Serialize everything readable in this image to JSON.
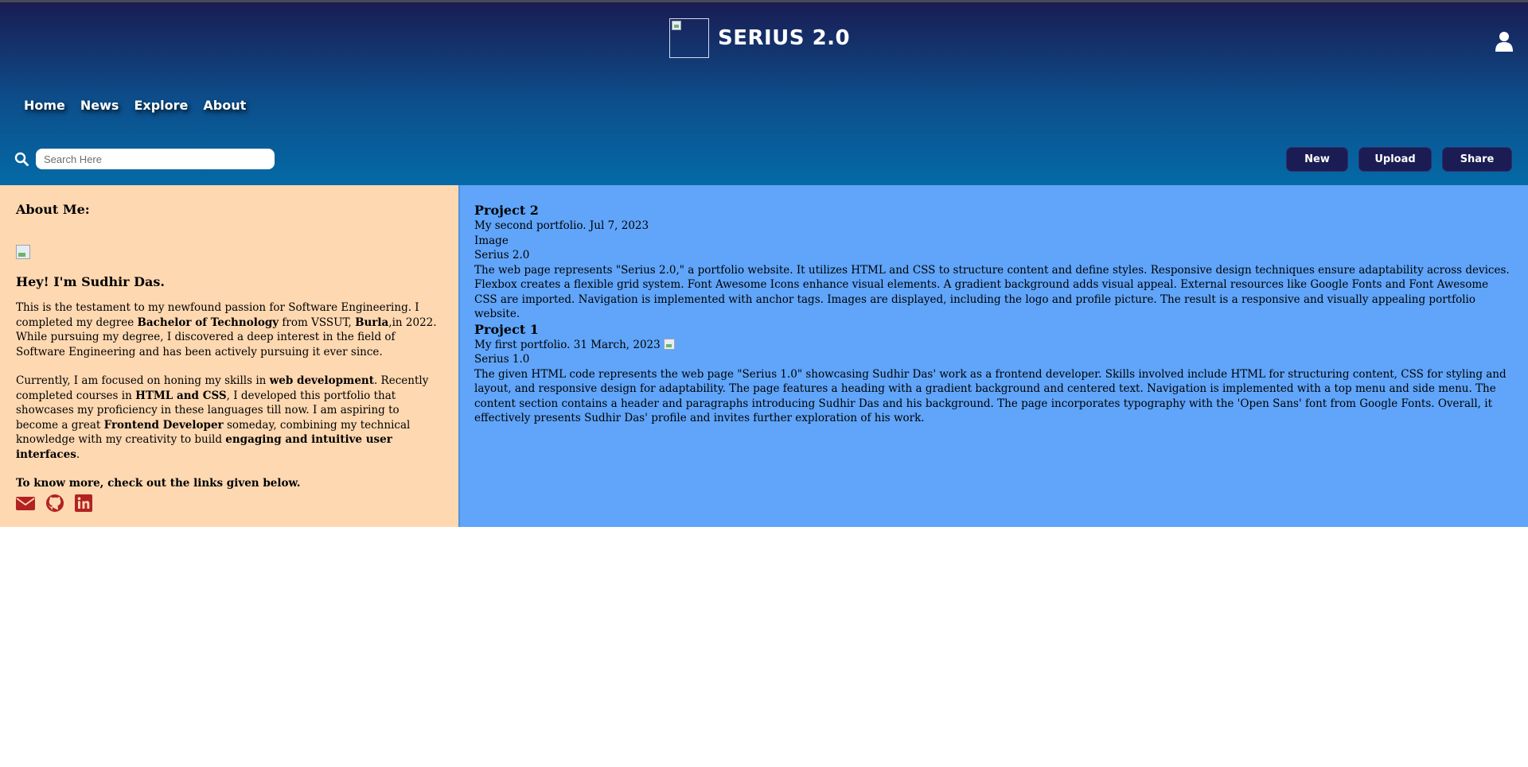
{
  "header": {
    "title": "SERIUS 2.0",
    "nav": [
      "Home",
      "News",
      "Explore",
      "About"
    ],
    "search_placeholder": "Search Here",
    "buttons": {
      "new": "New",
      "upload": "Upload",
      "share": "Share"
    }
  },
  "about": {
    "heading": "About Me:",
    "greeting": "Hey! I'm Sudhir Das.",
    "p1": {
      "a": "This is the testament to my newfound passion for Software Engineering. I completed my degree ",
      "b": "Bachelor of Technology",
      "c": " from VSSUT, ",
      "d": "Burla",
      "e": ",in 2022. While pursuing my degree, I discovered a deep interest in the field of Software Engineering and has been actively pursuing it ever since."
    },
    "p2": {
      "a": "Currently, I am focused on honing my skills in ",
      "b": "web development",
      "c": ". Recently completed courses in ",
      "d": "HTML and CSS",
      "e": ", I developed this portfolio that showcases my proficiency in these languages till now. I am aspiring to become a great ",
      "f": "Frontend Developer",
      "g": " someday, combining my technical knowledge with my creativity to build ",
      "h": "engaging and intuitive user interfaces",
      "i": "."
    },
    "p3": "To know more, check out the links given below.",
    "social_icons": [
      "envelope-icon",
      "github-icon",
      "linkedin-icon"
    ]
  },
  "projects": [
    {
      "title": "Project 2",
      "meta": "My second portfolio. Jul 7, 2023",
      "image_label": "Image",
      "name": "Serius 2.0",
      "description": "The web page represents \"Serius 2.0,\" a portfolio website. It utilizes HTML and CSS to structure content and define styles. Responsive design techniques ensure adaptability across devices. Flexbox creates a flexible grid system. Font Awesome Icons enhance visual elements. A gradient background adds visual appeal. External resources like Google Fonts and Font Awesome CSS are imported. Navigation is implemented with anchor tags. Images are displayed, including the logo and profile picture. The result is a responsive and visually appealing portfolio website."
    },
    {
      "title": "Project 1",
      "meta": "My first portfolio. 31 March, 2023",
      "name": "Serius 1.0",
      "description": "The given HTML code represents the web page \"Serius 1.0\" showcasing Sudhir Das' work as a frontend developer. Skills involved include HTML for structuring content, CSS for styling and layout, and responsive design for adaptability. The page features a heading with a gradient background and centered text. Navigation is implemented with a top menu and side menu. The content section contains a header and paragraphs introducing Sudhir Das and his background. The page incorporates typography with the 'Open Sans' font from Google Fonts. Overall, it effectively presents Sudhir Das' profile and invites further exploration of his work."
    }
  ],
  "colors": {
    "header_top": "#1a1c53",
    "header_bottom": "#046aa6",
    "about_bg": "#fed8b1",
    "projects_bg": "#60a5fa",
    "button_bg": "#1a1c53",
    "social_icon": "#b22222"
  }
}
